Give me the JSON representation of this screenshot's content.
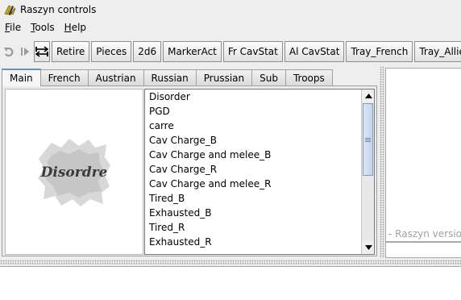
{
  "window": {
    "title": "Raszyn controls"
  },
  "menu": {
    "file": "File",
    "tools": "Tools",
    "help": "Help"
  },
  "toolbar": {
    "buttons": [
      "Retire",
      "Pieces",
      "2d6",
      "MarkerAct",
      "Fr CavStat",
      "Al CavStat",
      "Tray_French",
      "Tray_Allied"
    ]
  },
  "tabs": [
    "Main",
    "French",
    "Austrian",
    "Russian",
    "Prussian",
    "Sub",
    "Troops"
  ],
  "active_tab": "Main",
  "image": {
    "text": "Disordre"
  },
  "list": {
    "items": [
      "Disorder",
      "PGD",
      "carre",
      "Cav Charge_B",
      "Cav Charge and melee_B",
      "Cav Charge_R",
      "Cav Charge and melee_R",
      "Tired_B",
      "Exhausted_B",
      "Tired_R",
      "Exhausted_R"
    ]
  },
  "right": {
    "version_text": "- Raszyn version"
  },
  "colors": {
    "tab_accent": "#6a8ebd",
    "scroll_thumb": "#c3d4e8",
    "app_icon": "#e0b000"
  }
}
